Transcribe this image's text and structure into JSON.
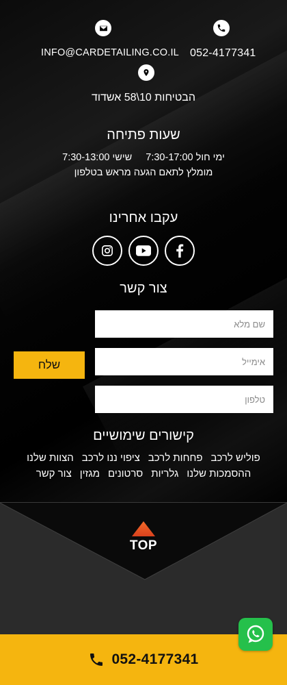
{
  "contact": {
    "phone": "052-4177341",
    "email": "INFO@CARDETAILING.CO.IL",
    "address": "הבטיחות 10\\58 אשדוד"
  },
  "hours": {
    "title": "שעות פתיחה",
    "weekday": "ימי חול 7:30-17:00",
    "friday": "שישי 7:30-13:00",
    "note": "מומלץ לתאם הגעה מראש בטלפון"
  },
  "social": {
    "title": "עקבו אחרינו",
    "items": [
      "facebook",
      "youtube",
      "instagram"
    ]
  },
  "form": {
    "title": "צור קשר",
    "name_placeholder": "שם מלא",
    "email_placeholder": "אימייל",
    "phone_placeholder": "טלפון",
    "submit_label": "שלח"
  },
  "links": {
    "title": "קישורים שימושיים",
    "row1": [
      "פוליש לרכב",
      "פחחות לרכב",
      "ציפוי ננו לרכב",
      "הצוות שלנו"
    ],
    "row2": [
      "ההסמכות שלנו",
      "גלריות",
      "סרטונים",
      "מגזין",
      "צור קשר"
    ]
  },
  "scroll_top": {
    "label": "TOP"
  },
  "bottom_bar": {
    "phone": "052-4177341"
  },
  "colors": {
    "accent": "#f5b50f",
    "whatsapp": "#25c04b",
    "top_arrow": "#f26b2a"
  }
}
